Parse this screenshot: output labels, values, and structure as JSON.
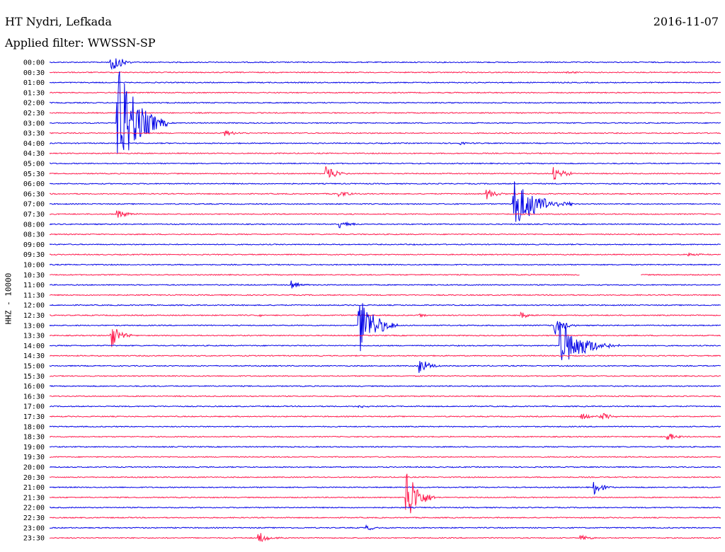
{
  "header": {
    "station": "HT Nydri, Lefkada",
    "date": "2016-11-07",
    "filter": "Applied filter: WWSSN-SP",
    "channel": "HHZ - 10000"
  },
  "colors": {
    "blue": "#0000e6",
    "red": "#ff1a4d"
  },
  "chart_data": {
    "type": "line",
    "title": "HT Nydri, Lefkada",
    "subtitle": "Applied filter: WWSSN-SP",
    "date": "2016-11-07",
    "ylabel": "HHZ - 10000",
    "row_labels": [
      "00:00",
      "00:30",
      "01:00",
      "01:30",
      "02:00",
      "02:30",
      "03:00",
      "03:30",
      "04:00",
      "04:30",
      "05:00",
      "05:30",
      "06:00",
      "06:30",
      "07:00",
      "07:30",
      "08:00",
      "08:30",
      "09:00",
      "09:30",
      "10:00",
      "10:30",
      "11:00",
      "11:30",
      "12:00",
      "12:30",
      "13:00",
      "13:30",
      "14:00",
      "14:30",
      "15:00",
      "15:30",
      "16:00",
      "16:30",
      "17:00",
      "17:30",
      "18:00",
      "18:30",
      "19:00",
      "19:30",
      "20:00",
      "20:30",
      "21:00",
      "21:30",
      "22:00",
      "22:30",
      "23:00",
      "23:30"
    ],
    "row_colors": [
      "blue",
      "red"
    ],
    "x_unit": "fraction of 30-minute row",
    "events": [
      {
        "row": 0,
        "x": 0.09,
        "amp": 1.4
      },
      {
        "row": 1,
        "x": 0.77,
        "amp": 0.2
      },
      {
        "row": 6,
        "x": 0.1,
        "amp": 7.0,
        "dur": 0.025
      },
      {
        "row": 7,
        "x": 0.26,
        "amp": 0.35
      },
      {
        "row": 8,
        "x": 0.61,
        "amp": 0.15
      },
      {
        "row": 11,
        "x": 0.41,
        "amp": 1.2
      },
      {
        "row": 11,
        "x": 0.75,
        "amp": 1.0
      },
      {
        "row": 13,
        "x": 0.43,
        "amp": 0.4
      },
      {
        "row": 13,
        "x": 0.65,
        "amp": 0.6
      },
      {
        "row": 14,
        "x": 0.69,
        "amp": 2.8,
        "dur": 0.03
      },
      {
        "row": 15,
        "x": 0.1,
        "amp": 0.5
      },
      {
        "row": 16,
        "x": 0.43,
        "amp": 0.5
      },
      {
        "row": 18,
        "x": 0.53,
        "amp": 0.1
      },
      {
        "row": 19,
        "x": 0.95,
        "amp": 0.2
      },
      {
        "row": 22,
        "x": 0.36,
        "amp": 0.4
      },
      {
        "row": 25,
        "x": 0.31,
        "amp": 0.15
      },
      {
        "row": 25,
        "x": 0.55,
        "amp": 0.2
      },
      {
        "row": 25,
        "x": 0.7,
        "amp": 0.5
      },
      {
        "row": 26,
        "x": 0.46,
        "amp": 3.5,
        "dur": 0.02
      },
      {
        "row": 26,
        "x": 0.75,
        "amp": 1.2
      },
      {
        "row": 27,
        "x": 0.09,
        "amp": 1.5
      },
      {
        "row": 28,
        "x": 0.76,
        "amp": 2.5,
        "dur": 0.03
      },
      {
        "row": 30,
        "x": 0.55,
        "amp": 1.0
      },
      {
        "row": 34,
        "x": 0.46,
        "amp": 0.2
      },
      {
        "row": 35,
        "x": 0.79,
        "amp": 0.5
      },
      {
        "row": 35,
        "x": 0.82,
        "amp": 0.5
      },
      {
        "row": 37,
        "x": 0.92,
        "amp": 0.5
      },
      {
        "row": 42,
        "x": 0.81,
        "amp": 0.8
      },
      {
        "row": 43,
        "x": 0.53,
        "amp": 3.5,
        "dur": 0.015
      },
      {
        "row": 46,
        "x": 0.47,
        "amp": 0.3
      },
      {
        "row": 47,
        "x": 0.31,
        "amp": 0.7
      },
      {
        "row": 47,
        "x": 0.79,
        "amp": 0.3
      }
    ],
    "gaps": [
      {
        "row": 21,
        "x_start": 0.79,
        "x_end": 0.88
      }
    ]
  }
}
